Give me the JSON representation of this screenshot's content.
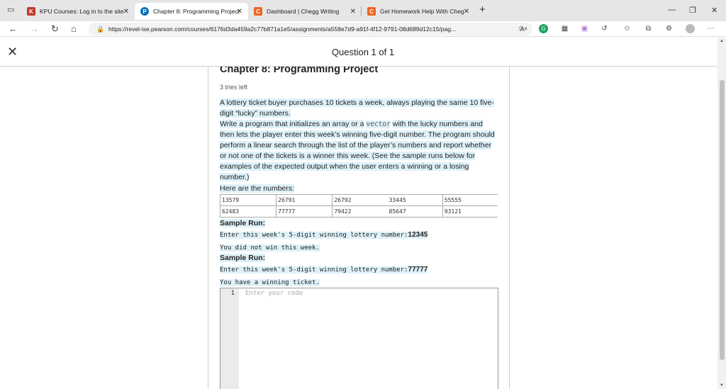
{
  "browser": {
    "tabs": [
      {
        "title": "KPU Courses: Log in to the site",
        "favicon_color": "#c0392b",
        "favicon_glyph": "K"
      },
      {
        "title": "Chapter 8: Programming Project",
        "favicon_color": "#0b6fb8",
        "favicon_glyph": "P"
      },
      {
        "title": "Dashboard | Chegg Writing",
        "favicon_color": "#f16521",
        "favicon_glyph": "C"
      },
      {
        "title": "Get Homework Help With Chegg",
        "favicon_color": "#f16521",
        "favicon_glyph": "C"
      }
    ],
    "url": "https://revel-ise.pearson.com/courses/6176d3da459a2c77b871a1e5/assignments/a558e7d9-a91f-4f12-9791-08d689d12c15/pag...",
    "reader_label": "Aᵃ"
  },
  "header": {
    "title": "Question 1 of 1"
  },
  "question": {
    "heading": "Chapter 8: Programming Project",
    "tries": "3 tries left",
    "p1": "A lottery ticket buyer purchases 10 tickets a week, always playing the same 10 five-digit “lucky” numbers.",
    "p2a": "Write a program that initializes an array or a",
    "p2code": "vector",
    "p2b": "with the lucky numbers and then lets the player enter this week’s winning five-digit number. The program should perform a linear search through the list of the player’s numbers and report whether or not one of the tickets is a winner this week. (See the sample runs below for examples of the expected output when the user enters a winning or a losing number.)",
    "p3": "Here are the numbers:",
    "numbers": [
      [
        "13579",
        "26791",
        "26792",
        "33445",
        "55555"
      ],
      [
        "62483",
        "77777",
        "79422",
        "85647",
        "93121"
      ]
    ],
    "sample_label": "Sample Run:",
    "run1_prompt": "Enter this week's 5-digit winning lottery number:",
    "run1_input": "12345",
    "run1_output": "You did not win this week.",
    "run2_prompt": "Enter this week's 5-digit winning lottery number:",
    "run2_input": "77777",
    "run2_output": "You have a winning ticket.",
    "editor_line": "1",
    "editor_placeholder": "Enter your code"
  }
}
